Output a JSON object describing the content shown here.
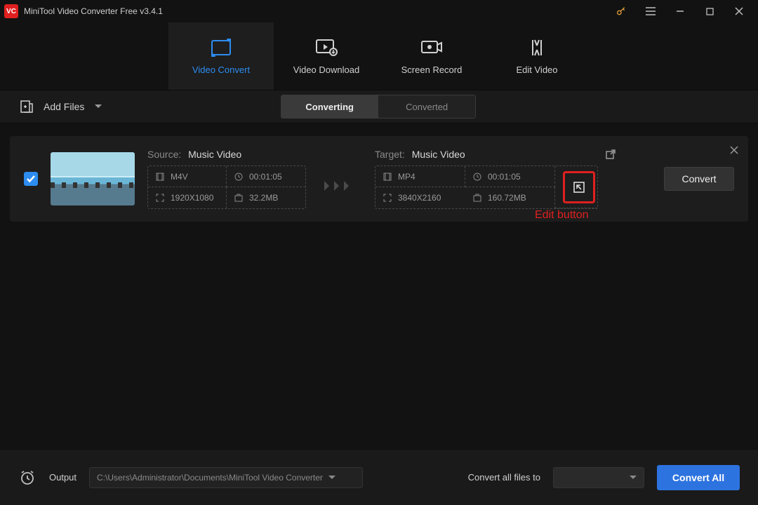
{
  "app": {
    "title": "MiniTool Video Converter Free v3.4.1"
  },
  "nav": {
    "convert": "Video Convert",
    "download": "Video Download",
    "record": "Screen Record",
    "edit": "Edit Video"
  },
  "toolbar": {
    "add_files": "Add Files",
    "seg_converting": "Converting",
    "seg_converted": "Converted"
  },
  "item": {
    "source_label": "Source:",
    "source_name": "Music Video",
    "target_label": "Target:",
    "target_name": "Music Video",
    "source": {
      "format": "M4V",
      "duration": "00:01:05",
      "resolution": "1920X1080",
      "size": "32.2MB"
    },
    "target": {
      "format": "MP4",
      "duration": "00:01:05",
      "resolution": "3840X2160",
      "size": "160.72MB"
    },
    "convert_btn": "Convert",
    "edit_annotation": "Edit button"
  },
  "footer": {
    "output_label": "Output",
    "output_path": "C:\\Users\\Administrator\\Documents\\MiniTool Video Converter",
    "convert_all_to": "Convert all files to",
    "convert_all_btn": "Convert All"
  }
}
